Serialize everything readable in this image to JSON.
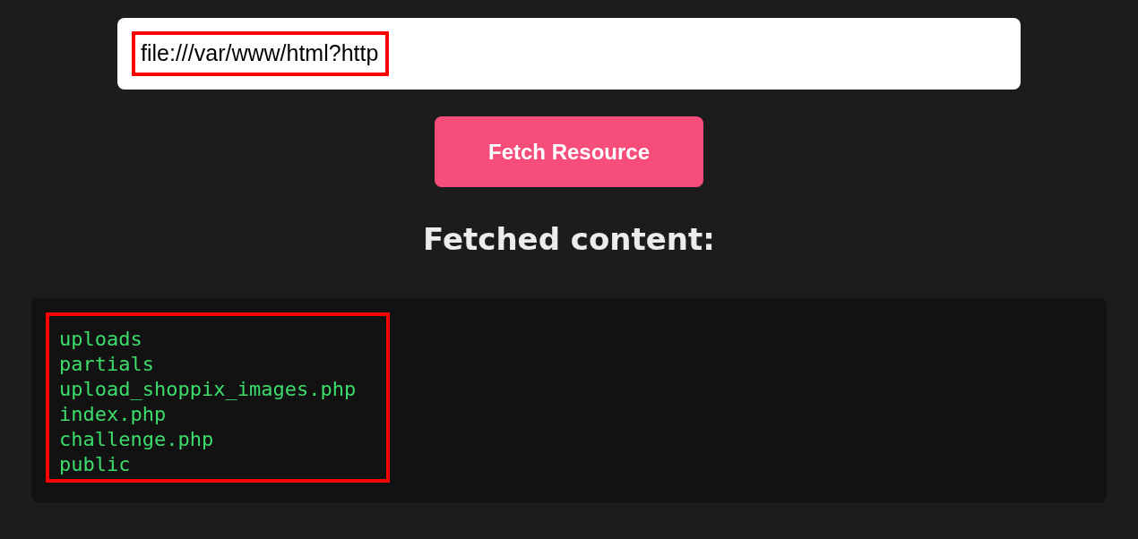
{
  "url_field": {
    "value": "file:///var/www/html?http",
    "highlighted": true
  },
  "fetch_button": {
    "label": "Fetch Resource"
  },
  "result_heading": "Fetched content:",
  "output": {
    "highlighted": true,
    "lines": [
      "uploads",
      "partials",
      "upload_shoppix_images.php",
      "index.php",
      "challenge.php",
      "public"
    ]
  }
}
